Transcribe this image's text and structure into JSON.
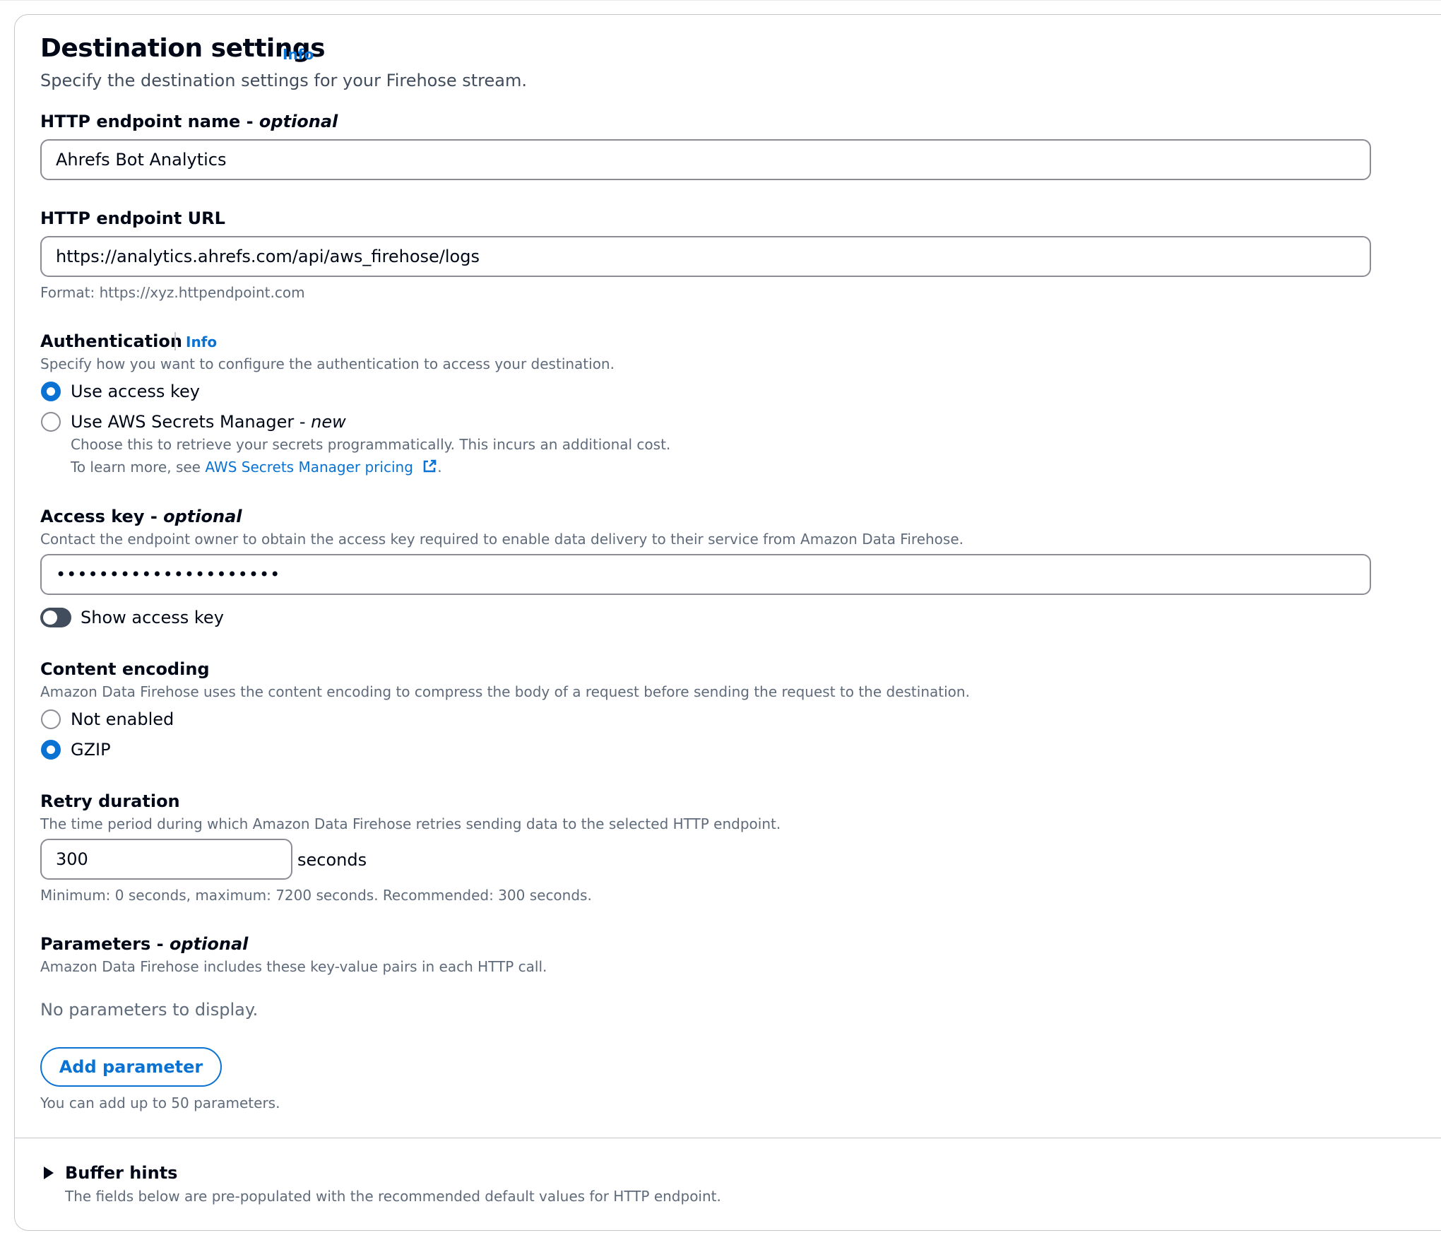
{
  "section": {
    "title": "Destination settings",
    "info_label": "Info",
    "description": "Specify the destination settings for your Firehose stream."
  },
  "endpoint_name": {
    "label": "HTTP endpoint name - ",
    "optional": "optional",
    "value": "Ahrefs Bot Analytics"
  },
  "endpoint_url": {
    "label": "HTTP endpoint URL",
    "value": "https://analytics.ahrefs.com/api/aws_firehose/logs",
    "hint": "Format: https://xyz.httpendpoint.com"
  },
  "authentication": {
    "label": "Authentication",
    "info_label": "Info",
    "description": "Specify how you want to configure the authentication to access your destination.",
    "options": [
      {
        "label": "Use access key",
        "selected": true
      },
      {
        "label": "Use AWS Secrets Manager - ",
        "suffix": "new",
        "selected": false,
        "description": "Choose this to retrieve your secrets programmatically. This incurs an additional cost.",
        "learn_more_prefix": "To learn more, see ",
        "learn_more_link": "AWS Secrets Manager pricing",
        "learn_more_suffix": "."
      }
    ]
  },
  "access_key": {
    "label": "Access key - ",
    "optional": "optional",
    "description": "Contact the endpoint owner to obtain the access key required to enable data delivery to their service from Amazon Data Firehose.",
    "masked_value": "•••••••••••••••••••••",
    "toggle_label": "Show access key",
    "toggle_on": false
  },
  "content_encoding": {
    "label": "Content encoding",
    "description": "Amazon Data Firehose uses the content encoding to compress the body of a request before sending the request to the destination.",
    "options": [
      {
        "label": "Not enabled",
        "selected": false
      },
      {
        "label": "GZIP",
        "selected": true
      }
    ]
  },
  "retry_duration": {
    "label": "Retry duration",
    "description": "The time period during which Amazon Data Firehose retries sending data to the selected HTTP endpoint.",
    "value": "300",
    "unit": "seconds",
    "hint": "Minimum: 0 seconds, maximum: 7200 seconds. Recommended: 300 seconds."
  },
  "parameters": {
    "label": "Parameters - ",
    "optional": "optional",
    "description": "Amazon Data Firehose includes these key-value pairs in each HTTP call.",
    "empty_text": "No parameters to display.",
    "add_button": "Add parameter",
    "limit_hint": "You can add up to 50 parameters."
  },
  "buffer_hints": {
    "label": "Buffer hints",
    "description": "The fields below are pre-populated with the recommended default values for HTTP endpoint."
  },
  "colors": {
    "accent": "#0972d3",
    "text": "#000716",
    "muted": "#5f6b7a",
    "border": "#8c8c94",
    "toggle_off": "#414d5c"
  }
}
